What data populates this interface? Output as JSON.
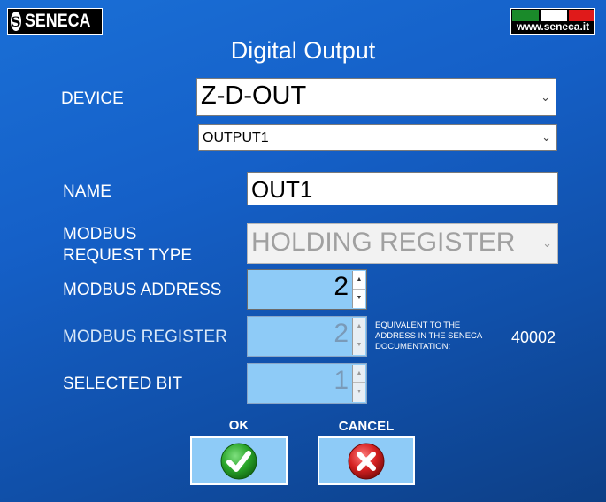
{
  "header": {
    "logo_text": "SENECA",
    "logo_mark": "S",
    "site_url": "www.seneca.it",
    "flag_colors": [
      "#1a8a2a",
      "#ffffff",
      "#e01a1a"
    ],
    "title": "Digital Output"
  },
  "form": {
    "device_label": "DEVICE",
    "device_value": "Z-D-OUT",
    "output_value": "OUTPUT1",
    "name_label": "NAME",
    "name_value": "OUT1",
    "request_type_label_line1": "MODBUS",
    "request_type_label_line2": "REQUEST TYPE",
    "request_type_value": "HOLDING REGISTER",
    "address_label": "MODBUS ADDRESS",
    "address_value": "2",
    "register_label": "MODBUS REGISTER",
    "register_value": "2",
    "equivalent_note_line1": "EQUIVALENT TO THE",
    "equivalent_note_line2": "ADDRESS IN THE SENECA",
    "equivalent_note_line3": "DOCUMENTATION:",
    "equivalent_value": "40002",
    "bit_label": "SELECTED BIT",
    "bit_value": "1"
  },
  "actions": {
    "ok_label": "OK",
    "cancel_label": "CANCEL"
  },
  "colors": {
    "background": "#1560c8",
    "field_accent": "#8ecbf7",
    "ok_green": "#2aa52a",
    "cancel_red": "#d42020"
  },
  "icons": {
    "ok": "check-circle-icon",
    "cancel": "x-circle-icon"
  }
}
